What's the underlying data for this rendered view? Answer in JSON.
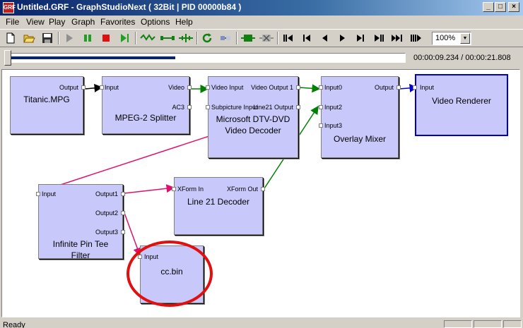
{
  "window": {
    "icon_label": "GRF",
    "title": "Untitled.GRF - GraphStudioNext ( 32Bit | PID 00000b84 )",
    "minimize": "_",
    "maximize": "□",
    "close": "×"
  },
  "menu": [
    "File",
    "View",
    "Play",
    "Graph",
    "Favorites",
    "Options",
    "Help"
  ],
  "toolbar": {
    "zoom": "100%",
    "icons": [
      "new-file-icon",
      "open-folder-icon",
      "save-icon",
      "play-icon",
      "pause-icon",
      "stop-icon",
      "step-icon",
      "seek-graph-icon",
      "connect-icon",
      "render-pin-icon",
      "refresh-icon",
      "filter-icon",
      "insert-filter-icon",
      "remove-filter-icon",
      "first-frame-icon",
      "prev-frame-icon",
      "back-icon",
      "forward-icon",
      "next-frame-icon",
      "last-frame-icon"
    ]
  },
  "seek": {
    "time": "00:00:09.234 / 00:00:21.808",
    "progress": 0.423
  },
  "filters": {
    "titanic": {
      "name": "Titanic.MPG",
      "pins": {
        "output": "Output"
      }
    },
    "splitter": {
      "name": "MPEG-2 Splitter",
      "pins": {
        "input": "Input",
        "video": "Video",
        "ac3": "AC3"
      }
    },
    "decoder": {
      "name": "Microsoft DTV-DVD Video Decoder",
      "pins": {
        "video_input": "Video Input",
        "subpicture": "Subpicture Input",
        "video_output": "Video Output 1",
        "line21": "Line21 Output"
      }
    },
    "mixer": {
      "name": "Overlay Mixer",
      "pins": {
        "input0": "Input0",
        "input2": "Input2",
        "input3": "Input3",
        "output": "Output"
      }
    },
    "renderer": {
      "name": "Video Renderer",
      "pins": {
        "input": "Input"
      }
    },
    "tee": {
      "name": "Infinite Pin Tee Filter",
      "pins": {
        "input": "Input",
        "output1": "Output1",
        "output2": "Output2",
        "output3": "Output3"
      }
    },
    "line21": {
      "name": "Line 21 Decoder",
      "pins": {
        "in": "XForm In",
        "out": "XForm Out"
      }
    },
    "ccbin": {
      "name": "cc.bin",
      "pins": {
        "input": "Input"
      }
    }
  },
  "colors": {
    "filter_bg": "#c8c8fa",
    "link_black": "#000000",
    "link_green": "#008000",
    "link_blue": "#0000c8",
    "link_magenta": "#e0106a",
    "annotation": "#e01010"
  },
  "status": {
    "text": "Ready"
  }
}
